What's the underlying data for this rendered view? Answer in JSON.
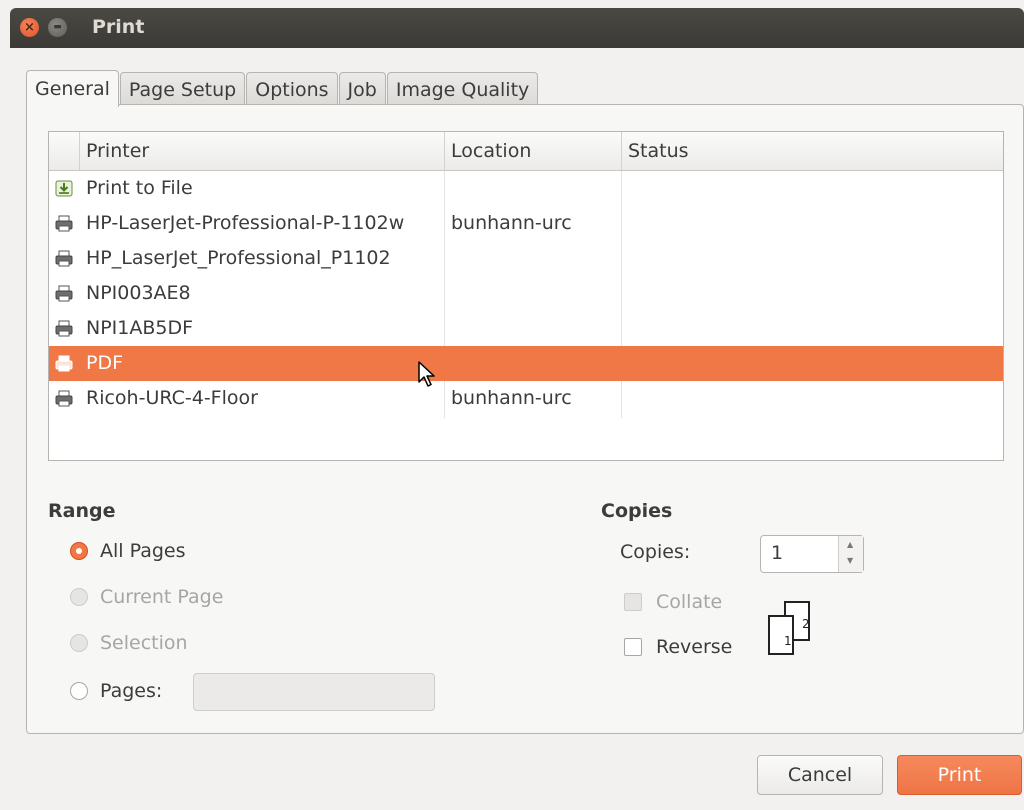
{
  "window": {
    "title": "Print"
  },
  "tabs": [
    "General",
    "Page Setup",
    "Options",
    "Job",
    "Image Quality"
  ],
  "printer_list": {
    "columns": [
      "Printer",
      "Location",
      "Status"
    ],
    "rows": [
      {
        "name": "Print to File",
        "location": "",
        "status": "",
        "icon": "file-download-icon"
      },
      {
        "name": "HP-LaserJet-Professional-P-1102w",
        "location": "bunhann-urc",
        "status": "",
        "icon": "printer-icon"
      },
      {
        "name": "HP_LaserJet_Professional_P1102",
        "location": "",
        "status": "",
        "icon": "printer-icon"
      },
      {
        "name": "NPI003AE8",
        "location": "",
        "status": "",
        "icon": "printer-icon"
      },
      {
        "name": "NPI1AB5DF",
        "location": "",
        "status": "",
        "icon": "printer-icon"
      },
      {
        "name": "PDF",
        "location": "",
        "status": "",
        "icon": "printer-icon",
        "selected": true
      },
      {
        "name": "Ricoh-URC-4-Floor",
        "location": "bunhann-urc",
        "status": "",
        "icon": "printer-icon"
      }
    ]
  },
  "range": {
    "title": "Range",
    "options": [
      {
        "label": "All Pages",
        "checked": true,
        "disabled": false
      },
      {
        "label": "Current Page",
        "checked": false,
        "disabled": true
      },
      {
        "label": "Selection",
        "checked": false,
        "disabled": true
      },
      {
        "label": "Pages:",
        "checked": false,
        "disabled": false
      }
    ],
    "pages_value": ""
  },
  "copies": {
    "title": "Copies",
    "label": "Copies:",
    "value": "1",
    "collate_label": "Collate",
    "reverse_label": "Reverse",
    "collate_icon_pages": [
      "1",
      "2"
    ]
  },
  "buttons": {
    "cancel": "Cancel",
    "print": "Print"
  },
  "colors": {
    "accent": "#f07746",
    "titlebar": "#3c3b37"
  }
}
